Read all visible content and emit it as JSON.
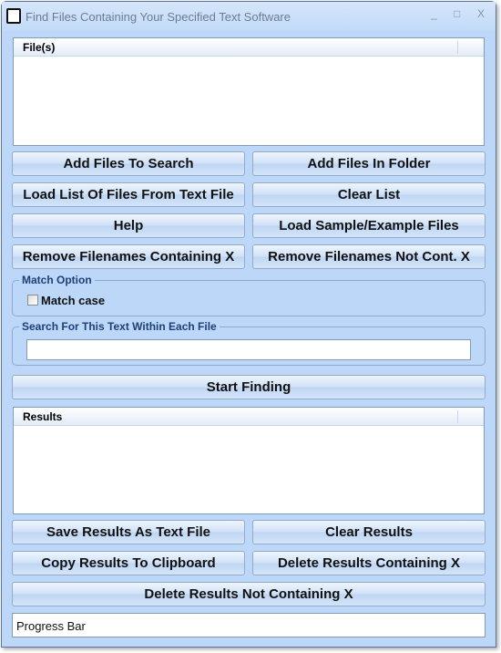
{
  "window": {
    "title": "Find Files Containing Your Specified Text Software",
    "minimize": "_",
    "maximize": "□",
    "close": "X"
  },
  "files_list": {
    "header": "File(s)"
  },
  "buttons": {
    "add_files": "Add Files To Search",
    "add_folder": "Add Files In Folder",
    "load_list": "Load List Of Files From Text File",
    "clear_list": "Clear List",
    "help": "Help",
    "load_sample": "Load Sample/Example Files",
    "remove_containing": "Remove Filenames Containing X",
    "remove_not": "Remove Filenames Not Cont. X",
    "start": "Start Finding",
    "save_results": "Save Results As Text File",
    "clear_results": "Clear Results",
    "copy_results": "Copy Results To Clipboard",
    "delete_containing": "Delete Results Containing X",
    "delete_not": "Delete Results Not Containing X"
  },
  "match_option": {
    "label": "Match Option",
    "match_case": "Match case",
    "checked": false
  },
  "search": {
    "label": "Search For This Text Within Each File",
    "value": ""
  },
  "results_list": {
    "header": "Results"
  },
  "progress": {
    "label": "Progress Bar"
  }
}
